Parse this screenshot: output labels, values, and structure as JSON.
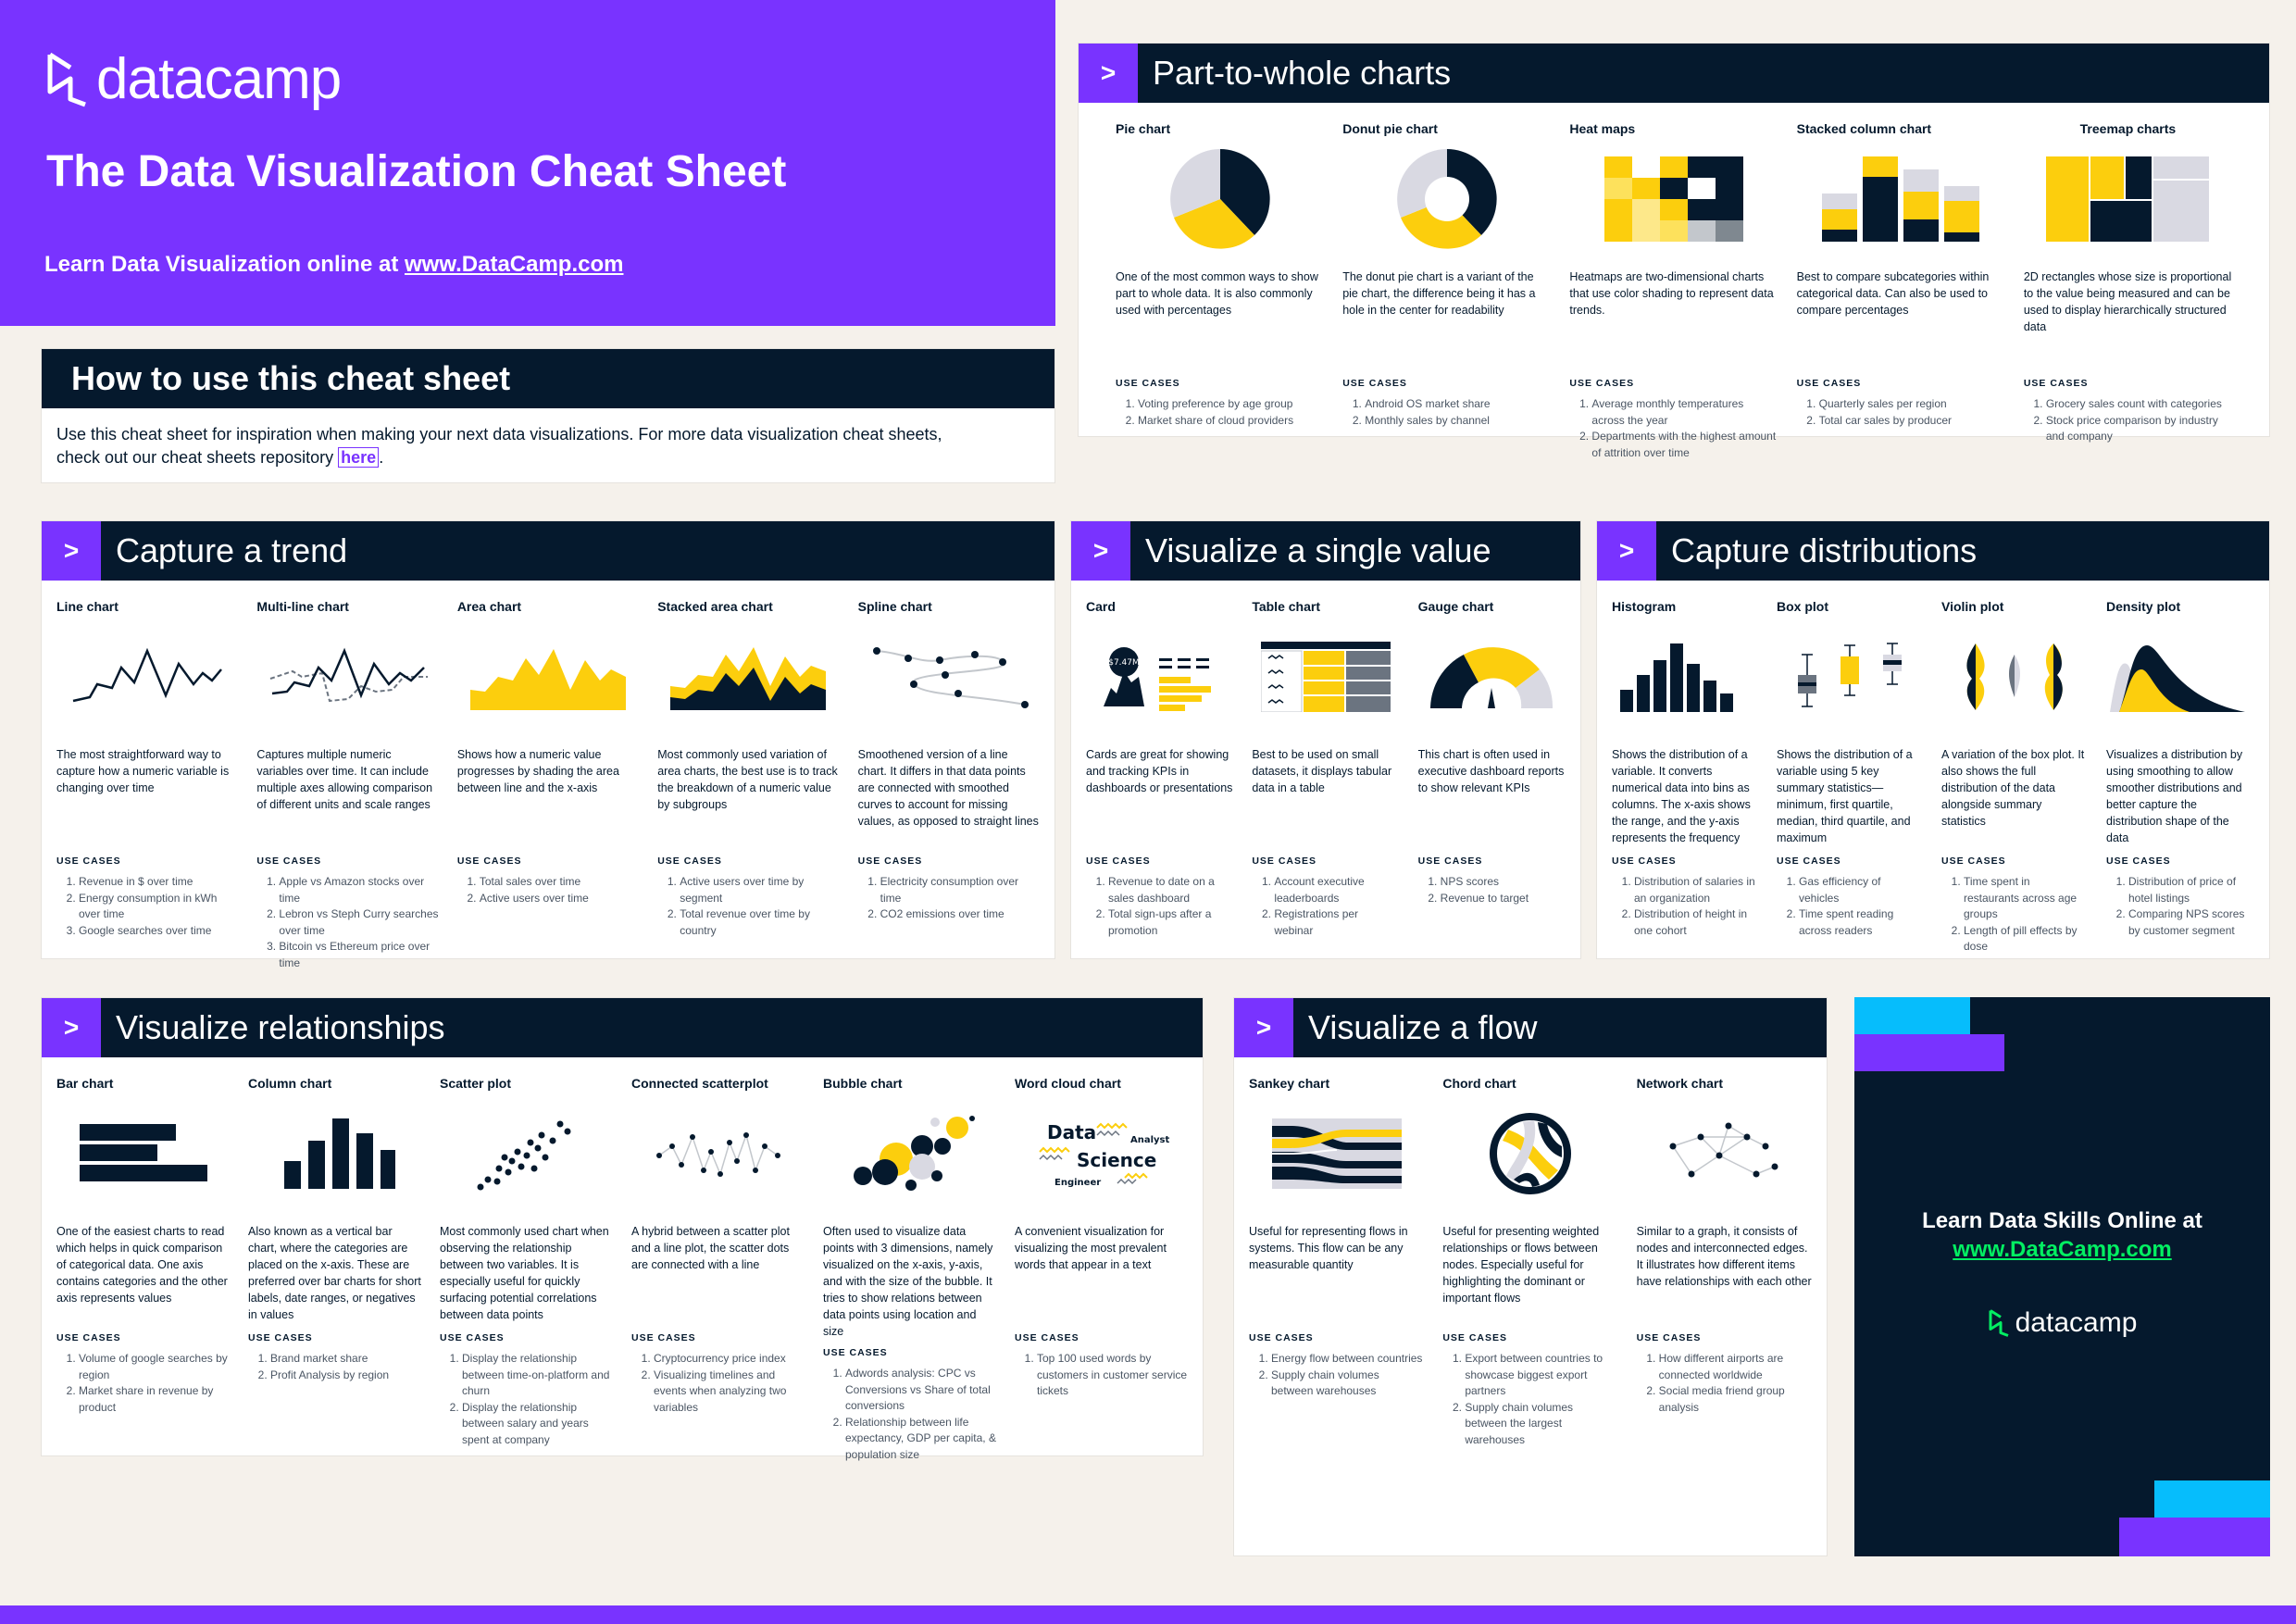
{
  "hero": {
    "logo_text": "datacamp",
    "title": "The Data Visualization Cheat Sheet",
    "subtitle_prefix": "Learn Data Visualization online at ",
    "subtitle_link": "www.DataCamp.com"
  },
  "how_to": {
    "title": "How to use this cheat sheet",
    "body_line1": "Use this cheat sheet for inspiration when making your next data visualizations. For more data visualization cheat sheets,",
    "body_line2_prefix": "check out our cheat sheets repository ",
    "body_link": "here",
    "body_suffix": "."
  },
  "use_cases_label": "USE CASES",
  "part_to_whole": {
    "title": "Part-to-whole charts",
    "charts": [
      {
        "title": "Pie chart",
        "desc": "One of the most common ways to show part to whole data. It is also commonly used with percentages",
        "uses": [
          "Voting preference by age group",
          "Market share of cloud providers"
        ]
      },
      {
        "title": "Donut pie chart",
        "desc": "The donut pie chart is a variant of the pie chart, the difference being it has a hole in the center for readability",
        "uses": [
          "Android OS market share",
          "Monthly sales by channel"
        ]
      },
      {
        "title": "Heat maps",
        "desc": "Heatmaps are two-dimensional charts that use color shading to represent data trends.",
        "uses": [
          "Average monthly temperatures across the year",
          "Departments with the highest amount of attrition over time"
        ]
      },
      {
        "title": "Stacked column chart",
        "desc": "Best to compare subcategories within categorical data. Can also be used to compare percentages",
        "uses": [
          "Quarterly sales per region",
          "Total car sales by producer"
        ]
      },
      {
        "title": "Treemap charts",
        "desc": "2D rectangles whose size is proportional to the value being measured and can be used to display hierarchically structured data",
        "uses": [
          "Grocery sales count with categories",
          "Stock price comparison by industry and company"
        ]
      }
    ]
  },
  "trend": {
    "title": "Capture a trend",
    "charts": [
      {
        "title": "Line chart",
        "desc": "The most straightforward way to capture how a numeric variable is changing over time",
        "uses": [
          "Revenue in $ over time",
          "Energy consumption in kWh over time",
          "Google searches over time"
        ]
      },
      {
        "title": "Multi-line chart",
        "desc": "Captures multiple numeric variables over time. It can include multiple axes allowing comparison of different units and scale ranges",
        "uses": [
          "Apple vs Amazon stocks over time",
          "Lebron vs Steph Curry searches over time",
          "Bitcoin vs Ethereum price over time"
        ]
      },
      {
        "title": "Area chart",
        "desc": "Shows how a numeric value progresses by shading the area between line and the x-axis",
        "uses": [
          "Total sales over time",
          "Active users over time"
        ]
      },
      {
        "title": "Stacked area chart",
        "desc": "Most commonly used variation of area charts, the best use is to track the breakdown of a numeric value by subgroups",
        "uses": [
          "Active users over time by segment",
          "Total revenue over time by country"
        ]
      },
      {
        "title": "Spline chart",
        "desc": "Smoothened version of a line chart. It differs in that data points are connected with smoothed curves to account for missing values, as opposed to straight lines",
        "uses": [
          "Electricity consumption over time",
          "CO2 emissions over time"
        ]
      }
    ]
  },
  "single_value": {
    "title": "Visualize a single value",
    "card_value": "$7.47M",
    "charts": [
      {
        "title": "Card",
        "desc": "Cards are great for showing and tracking KPIs in dashboards or presentations",
        "uses": [
          "Revenue to date on a sales dashboard",
          "Total sign-ups after a promotion"
        ]
      },
      {
        "title": "Table chart",
        "desc": "Best to be used on small datasets, it displays tabular data in a table",
        "uses": [
          "Account executive leaderboards",
          "Registrations per webinar"
        ]
      },
      {
        "title": "Gauge chart",
        "desc": "This chart is often used in executive dashboard reports to show relevant KPIs",
        "uses": [
          "NPS scores",
          "Revenue to target"
        ]
      }
    ]
  },
  "distributions": {
    "title": "Capture distributions",
    "charts": [
      {
        "title": "Histogram",
        "desc": "Shows the distribution of a variable. It converts numerical data into bins as columns. The x-axis shows the range, and the y-axis represents the frequency",
        "uses": [
          "Distribution of salaries in an organization",
          "Distribution of height in one cohort"
        ]
      },
      {
        "title": "Box plot",
        "desc": "Shows the distribution of a variable using 5 key summary statistics—minimum, first quartile, median, third quartile, and maximum",
        "uses": [
          "Gas efficiency of vehicles",
          "Time spent reading across readers"
        ]
      },
      {
        "title": "Violin plot",
        "desc": "A variation of the box plot. It also shows the full distribution of the data alongside summary statistics",
        "uses": [
          "Time spent in restaurants across age groups",
          "Length of pill effects by dose"
        ]
      },
      {
        "title": "Density plot",
        "desc": "Visualizes a distribution by using smoothing to allow smoother distributions and better capture the distribution shape of the data",
        "uses": [
          "Distribution of price of hotel listings",
          "Comparing NPS scores by customer segment"
        ]
      }
    ]
  },
  "relationships": {
    "title": "Visualize relationships",
    "wordcloud": {
      "w1": "Data",
      "w2": "Science",
      "w3": "Analyst",
      "w4": "Engineer"
    },
    "charts": [
      {
        "title": "Bar chart",
        "desc": "One of the easiest charts to read which helps in quick comparison of categorical data. One axis contains categories and the other axis represents values",
        "uses": [
          "Volume of google searches by region",
          "Market share in revenue by product"
        ]
      },
      {
        "title": "Column chart",
        "desc": "Also known as a vertical bar chart, where the categories are placed on the x-axis. These are preferred over bar charts for short labels,  date ranges, or negatives in values",
        "uses": [
          "Brand market share",
          "Profit Analysis by region"
        ]
      },
      {
        "title": "Scatter plot",
        "desc": "Most commonly used chart when observing the relationship between two variables. It is especially useful for quickly surfacing potential correlations between data points",
        "uses": [
          "Display the relationship between time-on-platform and churn",
          "Display the relationship between salary and years spent at company"
        ]
      },
      {
        "title": "Connected scatterplot",
        "desc": "A hybrid between a scatter plot and a line plot, the scatter dots are connected with a line",
        "uses": [
          "Cryptocurrency price index",
          "Visualizing timelines and events when analyzing two variables"
        ]
      },
      {
        "title": "Bubble chart",
        "desc": "Often used to visualize data points with 3 dimensions, namely visualized on the x-axis, y-axis, and with the size of the bubble. It tries to show relations between data points using location and size",
        "uses": [
          "Adwords analysis: CPC vs Conversions vs Share of total conversions",
          "Relationship between life expectancy, GDP per capita, & population size"
        ]
      },
      {
        "title": "Word cloud chart",
        "desc": "A convenient visualization for visualizing the most prevalent words that appear in a text",
        "uses": [
          "Top 100 used words by customers in customer service tickets"
        ]
      }
    ]
  },
  "flow": {
    "title": "Visualize a flow",
    "charts": [
      {
        "title": "Sankey chart",
        "desc": "Useful for representing flows in systems. This flow can be any measurable quantity",
        "uses": [
          "Energy flow between countries",
          "Supply chain volumes between warehouses"
        ]
      },
      {
        "title": "Chord chart",
        "desc": "Useful for presenting weighted relationships or flows between nodes. Especially useful for highlighting the dominant or important flows",
        "uses": [
          "Export between countries to showcase biggest export partners",
          "Supply chain volumes between the largest warehouses"
        ]
      },
      {
        "title": "Network chart",
        "desc": "Similar to a graph, it consists of nodes and interconnected edges. It illustrates how different items have relationships with each other",
        "uses": [
          "How different airports are connected worldwide",
          "Social media friend group analysis"
        ]
      }
    ]
  },
  "promo": {
    "line1": "Learn Data Skills Online at",
    "link": "www.DataCamp.com",
    "logo_text": "datacamp"
  },
  "colors": {
    "purple": "#7933ff",
    "navy": "#05192d",
    "yellow": "#fcce0d",
    "grey": "#d9d9e2",
    "cyan": "#06bdfc",
    "green": "#03ef62"
  }
}
